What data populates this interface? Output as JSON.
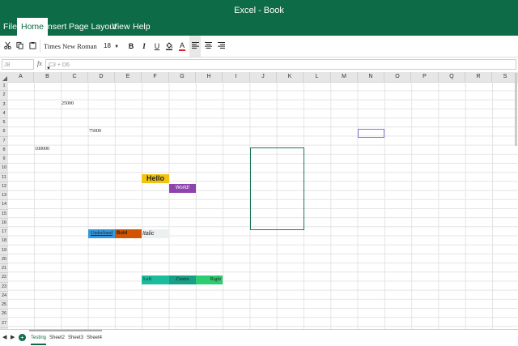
{
  "window": {
    "title": "Excel - Book"
  },
  "menu": {
    "items": [
      "File",
      "Home",
      "Insert",
      "Page Layout",
      "View",
      "Help"
    ],
    "active": "Home"
  },
  "toolbar": {
    "font_name": "Times New Roman",
    "font_size": "18",
    "bold_label": "B",
    "italic_label": "I",
    "underline_label": "U",
    "font_color_label": "A",
    "font_color": "#e02020",
    "fill_color": "#222222"
  },
  "formula_bar": {
    "name_box": "J8",
    "fx": "fx",
    "formula": "C3 + D6"
  },
  "columns": [
    "A",
    "B",
    "C",
    "D",
    "E",
    "F",
    "G",
    "H",
    "I",
    "J",
    "K",
    "L",
    "M",
    "N",
    "O",
    "P",
    "Q",
    "R",
    "S"
  ],
  "rows": [
    "1",
    "2",
    "3",
    "4",
    "5",
    "6",
    "7",
    "8",
    "9",
    "10",
    "11",
    "12",
    "13",
    "14",
    "15",
    "16",
    "17",
    "18",
    "19",
    "20",
    "21",
    "22",
    "23",
    "24",
    "25",
    "26",
    "27"
  ],
  "cells": {
    "c3": "25000",
    "d6": "75000",
    "b8": "100000",
    "f11": "Hello",
    "g12": "World!",
    "d17": "Underlined",
    "e17": "Bold",
    "f17": "Italic",
    "f22": "Left",
    "g22": "Centre",
    "h22": "Right"
  },
  "colors": {
    "brand": "#0e6b47",
    "hello_bg": "#f1c40f",
    "world_bg": "#8e44ad",
    "underlined_bg": "#3498db",
    "bold_bg": "#d35400",
    "italic_bg": "#ecf0f1",
    "left_bg": "#1abc9c",
    "centre_bg": "#16a085",
    "right_bg": "#2ecc71"
  },
  "sheets": {
    "tabs": [
      "Testing",
      "Sheet2",
      "Sheet3",
      "Sheet4"
    ],
    "active": "Testing"
  }
}
